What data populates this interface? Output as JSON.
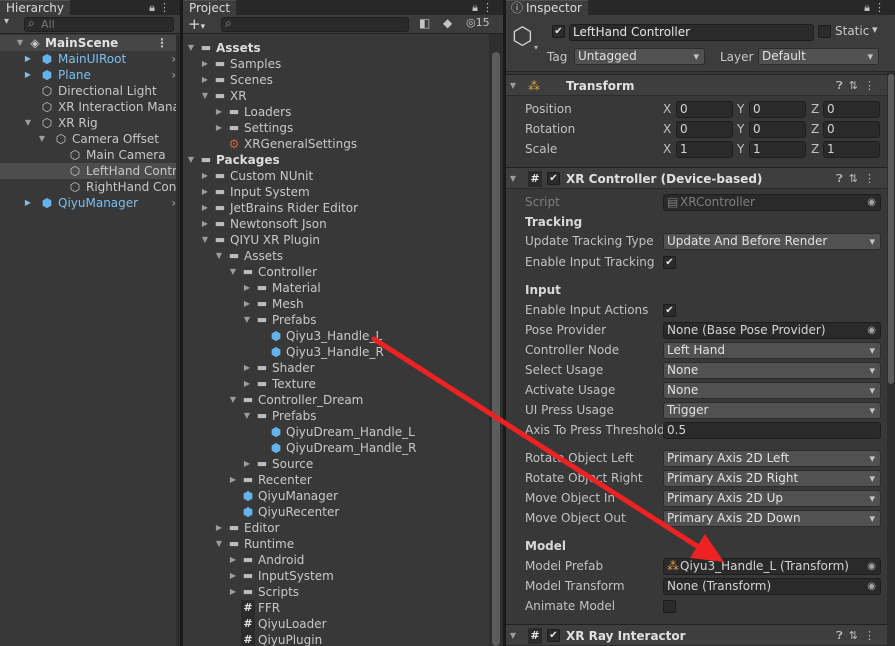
{
  "hierarchy": {
    "tab": "Hierarchy",
    "search_placeholder": "All",
    "scene": "MainScene",
    "items": [
      {
        "label": "MainUIRoot",
        "icon": "prefab-cube-icon",
        "prefab": true,
        "expandable": true
      },
      {
        "label": "Plane",
        "icon": "prefab-cube-icon",
        "prefab": true,
        "expandable": true
      },
      {
        "label": "Directional Light",
        "icon": "gameobject-cube-icon"
      },
      {
        "label": "XR Interaction Manager",
        "icon": "gameobject-cube-icon"
      },
      {
        "label": "XR Rig",
        "icon": "gameobject-cube-icon"
      },
      {
        "label": "Camera Offset",
        "icon": "gameobject-cube-icon"
      },
      {
        "label": "Main Camera",
        "icon": "gameobject-cube-icon"
      },
      {
        "label": "LeftHand Controller",
        "icon": "gameobject-cube-icon"
      },
      {
        "label": "RightHand Controller",
        "icon": "gameobject-cube-icon"
      },
      {
        "label": "QiyuManager",
        "icon": "prefab-cube-icon",
        "prefab": true,
        "expandable": true
      }
    ]
  },
  "project": {
    "tab": "Project",
    "add_label": "+",
    "hidden_count": "15",
    "items": [
      {
        "label": "Assets",
        "icon": "folder-icon",
        "bold": true
      },
      {
        "label": "Samples",
        "icon": "folder-icon"
      },
      {
        "label": "Scenes",
        "icon": "folder-icon"
      },
      {
        "label": "XR",
        "icon": "folder-icon"
      },
      {
        "label": "Loaders",
        "icon": "folder-icon"
      },
      {
        "label": "Settings",
        "icon": "folder-icon"
      },
      {
        "label": "XRGeneralSettings",
        "icon": "settings-asset-icon"
      },
      {
        "label": "Packages",
        "icon": "folder-icon",
        "bold": true
      },
      {
        "label": "Custom NUnit",
        "icon": "folder-icon"
      },
      {
        "label": "Input System",
        "icon": "folder-icon"
      },
      {
        "label": "JetBrains Rider Editor",
        "icon": "folder-icon"
      },
      {
        "label": "Newtonsoft Json",
        "icon": "folder-icon"
      },
      {
        "label": "QIYU XR Plugin",
        "icon": "folder-icon"
      },
      {
        "label": "Assets",
        "icon": "folder-icon"
      },
      {
        "label": "Controller",
        "icon": "folder-icon"
      },
      {
        "label": "Material",
        "icon": "folder-icon"
      },
      {
        "label": "Mesh",
        "icon": "folder-icon"
      },
      {
        "label": "Prefabs",
        "icon": "folder-icon"
      },
      {
        "label": "Qiyu3_Handle_L",
        "icon": "prefab-cube-icon"
      },
      {
        "label": "Qiyu3_Handle_R",
        "icon": "prefab-cube-icon"
      },
      {
        "label": "Shader",
        "icon": "folder-icon"
      },
      {
        "label": "Texture",
        "icon": "folder-icon"
      },
      {
        "label": "Controller_Dream",
        "icon": "folder-icon"
      },
      {
        "label": "Prefabs",
        "icon": "folder-icon"
      },
      {
        "label": "QiyuDream_Handle_L",
        "icon": "prefab-cube-icon"
      },
      {
        "label": "QiyuDream_Handle_R",
        "icon": "prefab-cube-icon"
      },
      {
        "label": "Source",
        "icon": "folder-icon"
      },
      {
        "label": "Recenter",
        "icon": "folder-icon"
      },
      {
        "label": "QiyuManager",
        "icon": "prefab-cube-icon"
      },
      {
        "label": "QiyuRecenter",
        "icon": "prefab-cube-icon"
      },
      {
        "label": "Editor",
        "icon": "folder-icon"
      },
      {
        "label": "Runtime",
        "icon": "folder-icon"
      },
      {
        "label": "Android",
        "icon": "folder-icon"
      },
      {
        "label": "InputSystem",
        "icon": "folder-icon"
      },
      {
        "label": "Scripts",
        "icon": "folder-icon"
      },
      {
        "label": "FFR",
        "icon": "script-icon"
      },
      {
        "label": "QiyuLoader",
        "icon": "script-icon"
      },
      {
        "label": "QiyuPlugin",
        "icon": "script-icon"
      }
    ]
  },
  "inspector": {
    "tab": "Inspector",
    "object_name": "LeftHand Controller",
    "static_label": "Static",
    "tag_label": "Tag",
    "tag_value": "Untagged",
    "layer_label": "Layer",
    "layer_value": "Default",
    "transform": {
      "title": "Transform",
      "position": {
        "label": "Position",
        "x": "0",
        "y": "0",
        "z": "0"
      },
      "rotation": {
        "label": "Rotation",
        "x": "0",
        "y": "0",
        "z": "0"
      },
      "scale": {
        "label": "Scale",
        "x": "1",
        "y": "1",
        "z": "1"
      },
      "axis_x": "X",
      "axis_y": "Y",
      "axis_z": "Z"
    },
    "xr_controller": {
      "title": "XR Controller (Device-based)",
      "script_label": "Script",
      "script_value": "XRController",
      "tracking_header": "Tracking",
      "update_tracking_label": "Update Tracking Type",
      "update_tracking_value": "Update And Before Render",
      "enable_tracking_label": "Enable Input Tracking",
      "input_header": "Input",
      "enable_actions_label": "Enable Input Actions",
      "pose_provider_label": "Pose Provider",
      "pose_provider_value": "None (Base Pose Provider)",
      "controller_node_label": "Controller Node",
      "controller_node_value": "Left Hand",
      "select_usage_label": "Select Usage",
      "select_usage_value": "None",
      "activate_usage_label": "Activate Usage",
      "activate_usage_value": "None",
      "ui_press_label": "UI Press Usage",
      "ui_press_value": "Trigger",
      "axis_threshold_label": "Axis To Press Threshold",
      "axis_threshold_value": "0.5",
      "rotate_left_label": "Rotate Object Left",
      "rotate_left_value": "Primary Axis 2D Left",
      "rotate_right_label": "Rotate Object Right",
      "rotate_right_value": "Primary Axis 2D Right",
      "move_in_label": "Move Object In",
      "move_in_value": "Primary Axis 2D Up",
      "move_out_label": "Move Object Out",
      "move_out_value": "Primary Axis 2D Down",
      "model_header": "Model",
      "model_prefab_label": "Model Prefab",
      "model_prefab_value": "Qiyu3_Handle_L (Transform)",
      "model_transform_label": "Model Transform",
      "model_transform_value": "None (Transform)",
      "animate_model_label": "Animate Model"
    },
    "ray_interactor": {
      "title": "XR Ray Interactor"
    }
  },
  "annotation": {
    "color": "#ee2222"
  }
}
